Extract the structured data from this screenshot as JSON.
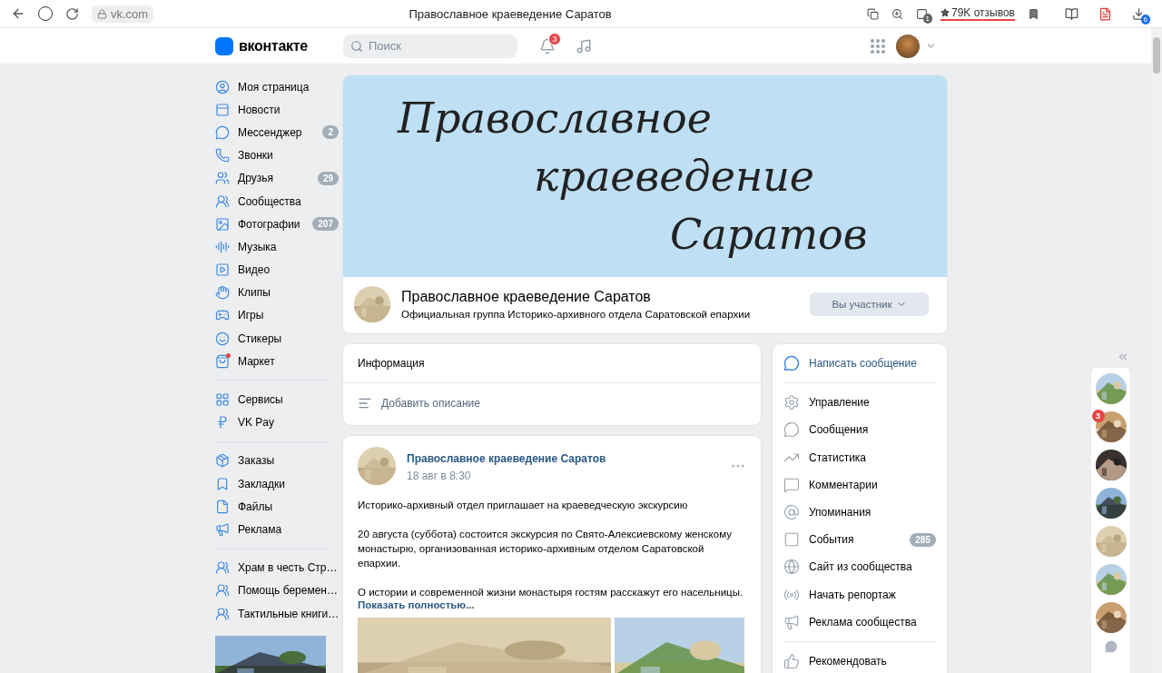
{
  "browser": {
    "address": "vk.com",
    "title": "Православное краеведение Саратов",
    "reviews": "79K отзывов",
    "tab_badge": "1",
    "downloads_badge": "6"
  },
  "header": {
    "logo": "вконтакте",
    "search": {
      "placeholder": "Поиск"
    },
    "notifications_badge": "3"
  },
  "nav": {
    "sections": [
      [
        {
          "label": "Моя страница"
        },
        {
          "label": "Новости"
        },
        {
          "label": "Мессенджер",
          "badge": "2"
        },
        {
          "label": "Звонки"
        },
        {
          "label": "Друзья",
          "badge": "29"
        },
        {
          "label": "Сообщества"
        },
        {
          "label": "Фотографии",
          "badge": "207"
        },
        {
          "label": "Музыка"
        },
        {
          "label": "Видео"
        },
        {
          "label": "Клипы"
        },
        {
          "label": "Игры"
        },
        {
          "label": "Стикеры"
        },
        {
          "label": "Маркет"
        }
      ],
      [
        {
          "label": "Сервисы"
        },
        {
          "label": "VK Pay"
        }
      ],
      [
        {
          "label": "Заказы"
        },
        {
          "label": "Закладки"
        },
        {
          "label": "Файлы"
        },
        {
          "label": "Реклама"
        }
      ],
      [
        {
          "label": "Храм в честь Стр…"
        },
        {
          "label": "Помощь беремен…"
        },
        {
          "label": "Тактильные книги…"
        }
      ]
    ]
  },
  "group": {
    "banner_lines": [
      "Православное",
      "краеведение",
      "Саратов"
    ],
    "name": "Православное краеведение Саратов",
    "description": "Официальная группа Историко-архивного отдела Саратовской епархии",
    "member_button": "Вы участник"
  },
  "info": {
    "title": "Информация",
    "add_description": "Добавить описание"
  },
  "post": {
    "author": "Православное краеведение Саратов",
    "time": "18 авг в 8:30",
    "paragraphs": [
      "Историко-архивный отдел приглашает на краеведческую экскурсию",
      "20 августа (суббота) состоится экскурсия по Свято-Алексиевскому женскому монастырю, организованная историко-архивным отделом Саратовской епархии.",
      "О истории и современной жизни монастыря гостям расскажут его насельницы."
    ],
    "more": "Показать полностью..."
  },
  "actions": {
    "primary": "Написать сообщение",
    "items": [
      {
        "label": "Управление"
      },
      {
        "label": "Сообщения"
      },
      {
        "label": "Статистика"
      },
      {
        "label": "Комментарии"
      },
      {
        "label": "Упоминания"
      },
      {
        "label": "События",
        "badge": "285"
      },
      {
        "label": "Сайт из сообщества"
      },
      {
        "label": "Начать репортаж"
      },
      {
        "label": "Реклама сообщества"
      }
    ],
    "recommend": "Рекомендовать"
  },
  "chats": [
    {
      "kind": "picture"
    },
    {
      "kind": "picture",
      "badge": "3"
    },
    {
      "kind": "picture"
    },
    {
      "kind": "picture"
    },
    {
      "kind": "picture"
    },
    {
      "kind": "picture"
    },
    {
      "kind": "picture"
    }
  ]
}
